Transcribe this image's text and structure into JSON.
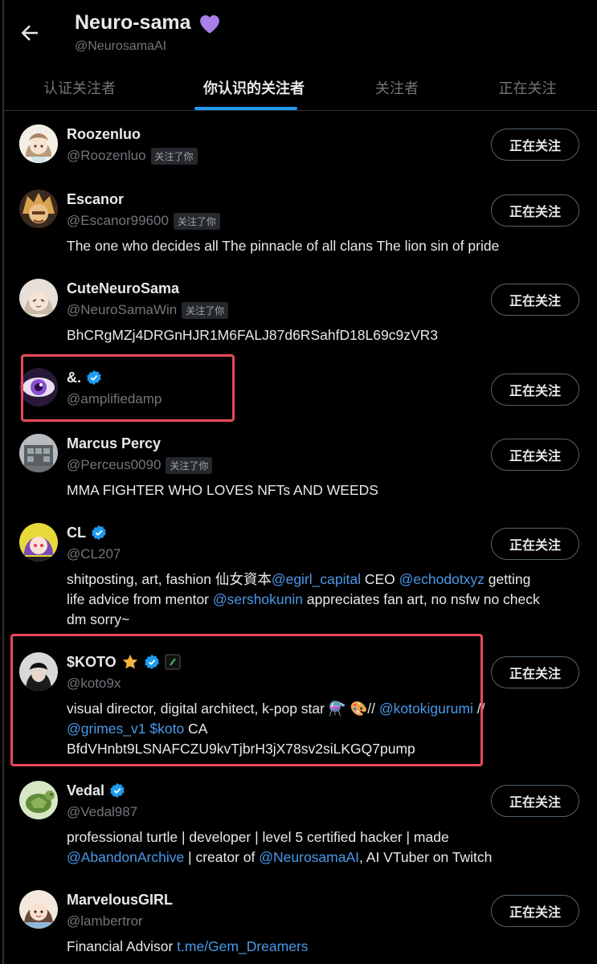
{
  "header": {
    "title": "Neuro-sama",
    "handle": "@NeurosamaAI",
    "heart_icon": "purple-heart-icon",
    "heart_color": "#a97ee8"
  },
  "tabs": [
    {
      "label": "认证关注者",
      "active": false
    },
    {
      "label": "你认识的关注者",
      "active": true
    },
    {
      "label": "关注者",
      "active": false
    },
    {
      "label": "正在关注",
      "active": false
    }
  ],
  "follow_button_label": "正在关注",
  "follows_you_label": "关注了你",
  "users": [
    {
      "name": "Roozenluo",
      "handle": "@Roozenluo",
      "follows_you": true,
      "verified": false,
      "bio": []
    },
    {
      "name": "Escanor",
      "handle": "@Escanor99600",
      "follows_you": true,
      "verified": false,
      "bio": [
        "The one who decides all The pinnacle of all clans The lion sin of pride"
      ]
    },
    {
      "name": "CuteNeuroSama",
      "handle": "@NeuroSamaWin",
      "follows_you": true,
      "verified": false,
      "bio": [
        "BhCRgMZj4DRGnHJR1M6FALJ87d6RSahfD18L69c9zVR3"
      ]
    },
    {
      "name": "&.",
      "handle": "@amplifiedamp",
      "follows_you": false,
      "verified": true,
      "bio": []
    },
    {
      "name": "Marcus Percy",
      "handle": "@Perceus0090",
      "follows_you": true,
      "verified": false,
      "bio": [
        "MMA FIGHTER WHO LOVES NFTs AND WEEDS"
      ]
    },
    {
      "name": "CL",
      "handle": "@CL207",
      "follows_you": false,
      "verified": true,
      "bio": [
        {
          "text": "shitposting, art, fashion 仙女資本"
        },
        {
          "link": "@egirl_capital"
        },
        {
          "text": " CEO "
        },
        {
          "link": "@echodotxyz"
        },
        {
          "text": " getting life advice from mentor "
        },
        {
          "link": "@sershokunin"
        },
        {
          "text": " appreciates fan art, no nsfw no check dm sorry~"
        }
      ]
    },
    {
      "name": "$KOTO",
      "handle": "@koto9x",
      "follows_you": false,
      "verified": true,
      "bio": [
        {
          "text": "visual director, digital architect, k-pop star ⚗️ 🎨// "
        },
        {
          "link": "@kotokigurumi"
        },
        {
          "text": " // "
        },
        {
          "link": "@grimes_v1"
        },
        {
          "text": " "
        },
        {
          "link": "$koto"
        },
        {
          "text": " CA BfdVHnbt9LSNAFCZU9kvTjbrH3jX78sv2siLKGQ7pump"
        }
      ]
    },
    {
      "name": "Vedal",
      "handle": "@Vedal987",
      "follows_you": false,
      "verified": true,
      "bio": [
        {
          "text": "professional turtle | developer | level 5 certified hacker | made "
        },
        {
          "link": "@AbandonArchive"
        },
        {
          "text": " | creator of "
        },
        {
          "link": "@NeurosamaAI"
        },
        {
          "text": ", AI VTuber on Twitch"
        }
      ]
    },
    {
      "name": "MarvelousGIRL",
      "handle": "@lambertror",
      "follows_you": false,
      "verified": false,
      "bio": [
        {
          "text": "Financial Advisor "
        },
        {
          "link": "t.me/Gem_Dreamers"
        }
      ]
    }
  ],
  "colors": {
    "accent": "#1d9bf0",
    "link": "#4a99e9",
    "highlight_box": "#e84a5f",
    "background": "#000000"
  }
}
